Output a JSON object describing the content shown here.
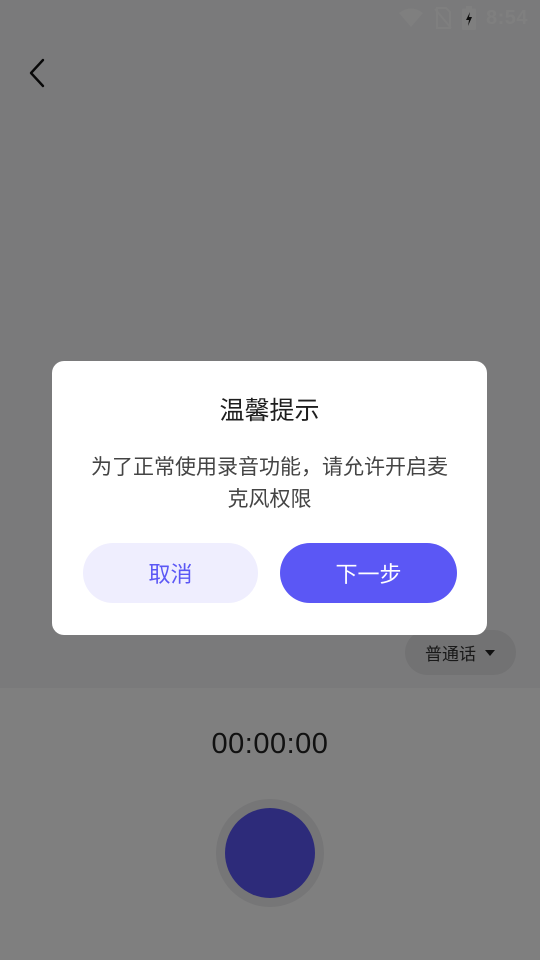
{
  "status_bar": {
    "time": "8:54",
    "icons": [
      "wifi-icon",
      "no-sim-icon",
      "battery-charging-icon"
    ]
  },
  "nav": {
    "back_icon": "chevron-left-icon"
  },
  "language_selector": {
    "label": "普通话",
    "icon": "caret-down-icon"
  },
  "recorder": {
    "timer": "00:00:00",
    "record_button_color": "#5b57f5"
  },
  "dialog": {
    "title": "温馨提示",
    "message": "为了正常使用录音功能，请允许开启麦克风权限",
    "cancel_label": "取消",
    "next_label": "下一步"
  },
  "colors": {
    "accent": "#5b57f5",
    "accent_light": "#efeefe",
    "overlay": "rgba(0,0,0,0.5)"
  }
}
